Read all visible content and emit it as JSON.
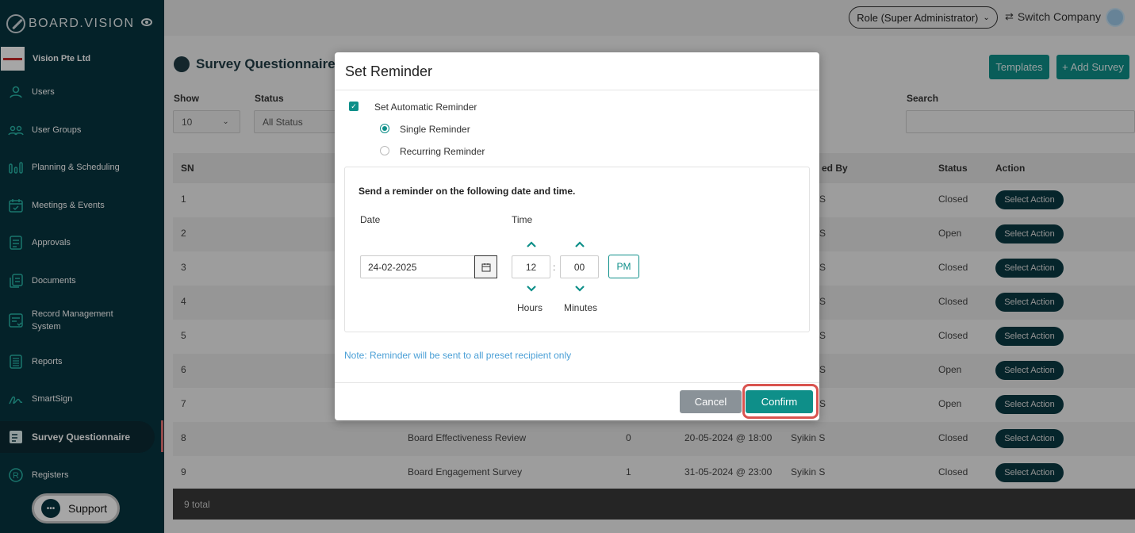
{
  "app": {
    "brand": "BOARD.VISION",
    "company": "Vision Pte Ltd"
  },
  "sidebar": {
    "items": [
      {
        "label": "Users",
        "icon": "user-icon"
      },
      {
        "label": "User Groups",
        "icon": "users-icon"
      },
      {
        "label": "Planning & Scheduling",
        "icon": "bar-chart-icon"
      },
      {
        "label": "Meetings & Events",
        "icon": "calendar-icon"
      },
      {
        "label": "Approvals",
        "icon": "clipboard-icon"
      },
      {
        "label": "Documents",
        "icon": "documents-icon"
      },
      {
        "label": "Record Management System",
        "icon": "record-icon"
      },
      {
        "label": "Reports",
        "icon": "report-icon"
      },
      {
        "label": "SmartSign",
        "icon": "signature-icon"
      },
      {
        "label": "Survey Questionnaire",
        "icon": "survey-icon",
        "active": true
      },
      {
        "label": "Registers",
        "icon": "registered-icon"
      }
    ],
    "support_label": "Support"
  },
  "topbar": {
    "role": "Role (Super Administrator)",
    "switch_company": "Switch Company"
  },
  "page": {
    "title": "Survey Questionnaire",
    "templates_label": "Templates",
    "add_label": "+ Add Survey",
    "filters": {
      "show_label": "Show",
      "show_value": "10",
      "status_label": "Status",
      "status_value": "All Status",
      "search_label": "Search"
    },
    "columns": {
      "sn": "SN",
      "created_by": "ed By",
      "status": "Status",
      "action": "Action"
    },
    "rows": [
      {
        "sn": "1",
        "title": "",
        "count": "",
        "date": "",
        "by": "S",
        "status": "Closed"
      },
      {
        "sn": "2",
        "title": "",
        "count": "",
        "date": "",
        "by": "S",
        "status": "Open"
      },
      {
        "sn": "3",
        "title": "",
        "count": "",
        "date": "",
        "by": "S",
        "status": "Closed"
      },
      {
        "sn": "4",
        "title": "",
        "count": "",
        "date": "",
        "by": "S",
        "status": "Closed"
      },
      {
        "sn": "5",
        "title": "",
        "count": "",
        "date": "",
        "by": "S",
        "status": "Closed"
      },
      {
        "sn": "6",
        "title": "",
        "count": "",
        "date": "",
        "by": "S",
        "status": "Open"
      },
      {
        "sn": "7",
        "title": "",
        "count": "",
        "date": "",
        "by": "S",
        "status": "Open"
      },
      {
        "sn": "8",
        "title": "Board Effectiveness Review",
        "count": "0",
        "date": "20-05-2024 @ 18:00",
        "by": "Syikin S",
        "status": "Closed"
      },
      {
        "sn": "9",
        "title": "Board Engagement Survey",
        "count": "1",
        "date": "31-05-2024 @ 23:00",
        "by": "Syikin S",
        "status": "Closed"
      }
    ],
    "action_label": "Select Action",
    "total": "9 total"
  },
  "modal": {
    "title": "Set Reminder",
    "auto_label": "Set Automatic Reminder",
    "single_label": "Single Reminder",
    "recurring_label": "Recurring Reminder",
    "heading": "Send a reminder on the following date and time.",
    "date_label": "Date",
    "time_label": "Time",
    "date_value": "24-02-2025",
    "hours_value": "12",
    "minutes_value": "00",
    "ampm": "PM",
    "hours_label": "Hours",
    "minutes_label": "Minutes",
    "note": "Note: Reminder will be sent to all preset recipient only",
    "cancel_label": "Cancel",
    "confirm_label": "Confirm"
  },
  "colors": {
    "sidebar": "#073540",
    "accent": "#0e8f89",
    "highlight": "#d9534f",
    "note": "#4a9fd6"
  }
}
